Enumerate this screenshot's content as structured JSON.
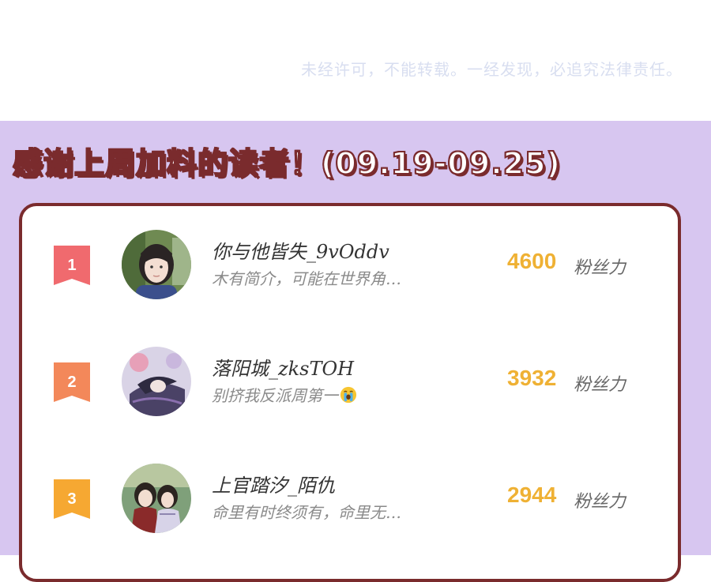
{
  "notice": "未经许可，不能转载。一经发现，必追究法律责任。",
  "banner_title": "感谢上周加料的读者！(09.19-09.25)",
  "colors": {
    "band": "#d7c6f0",
    "card_border": "#7a2b2d",
    "score": "#efb134",
    "rank_1": "#f06a6e",
    "rank_2": "#f3885a",
    "rank_3": "#f6a832"
  },
  "readers": [
    {
      "rank": "1",
      "name": "你与他皆失_9vOddv",
      "bio": "木有简介，可能在世界角…",
      "score": "4600",
      "unit": "粉丝力"
    },
    {
      "rank": "2",
      "name": "落阳城_zksTOH",
      "bio": "别挤我反派周第一",
      "bio_icon": "crying-face-icon",
      "score": "3932",
      "unit": "粉丝力"
    },
    {
      "rank": "3",
      "name": "上官踏汐_陌仇",
      "bio": "命里有时终须有，命里无…",
      "score": "2944",
      "unit": "粉丝力"
    }
  ]
}
